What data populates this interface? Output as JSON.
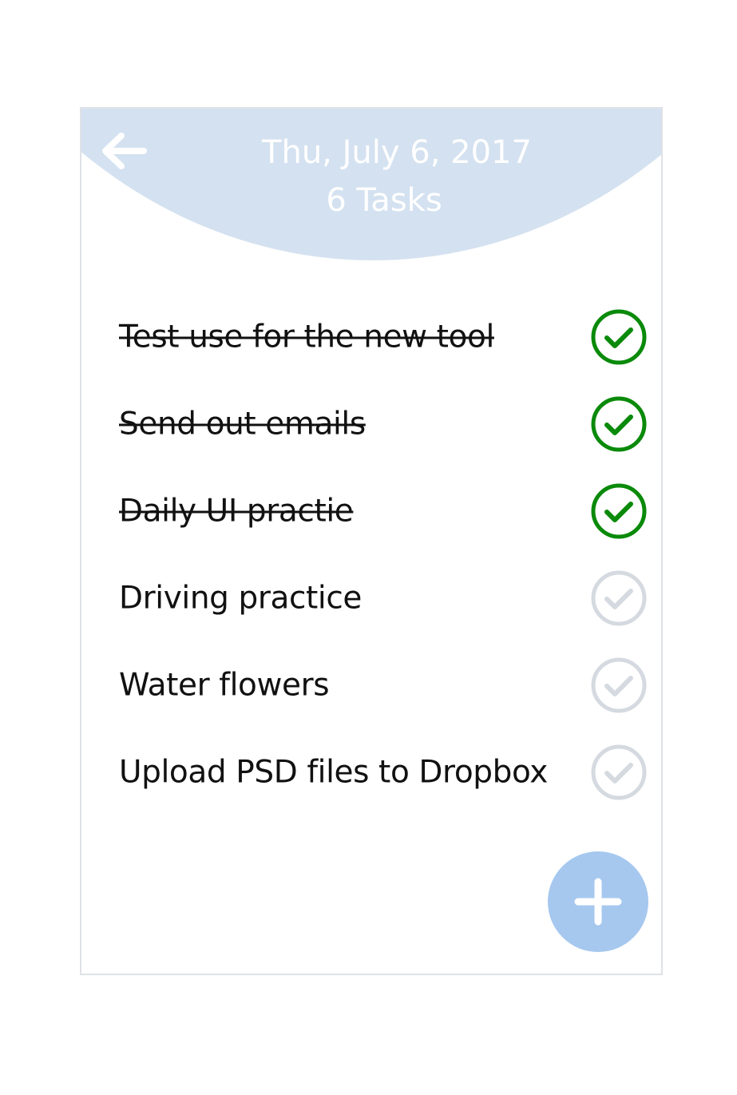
{
  "header": {
    "date": "Thu, July 6, 2017",
    "task_count": "6 Tasks",
    "back_icon": "arrow-left-icon",
    "background_color": "#d4e1f0"
  },
  "tasks": [
    {
      "label": "Test use for the new tool",
      "completed": true
    },
    {
      "label": "Send out emails",
      "completed": true
    },
    {
      "label": "Daily UI practie",
      "completed": true
    },
    {
      "label": "Driving practice",
      "completed": false
    },
    {
      "label": "Water flowers",
      "completed": false
    },
    {
      "label": "Upload PSD files to Dropbox",
      "completed": false
    }
  ],
  "colors": {
    "check_done": "#0a8a0a",
    "check_pending": "#d5dae0",
    "fab": "#a6c8ef"
  },
  "fab": {
    "icon": "plus-icon"
  }
}
